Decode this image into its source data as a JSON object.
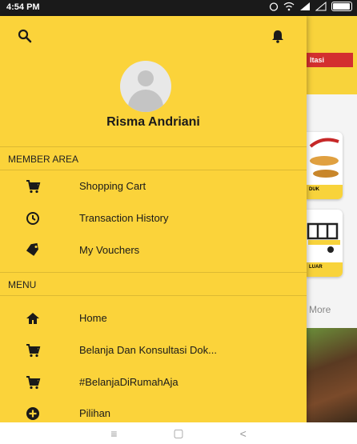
{
  "status": {
    "time": "4:54 PM"
  },
  "background": {
    "consult_label": "ltasi",
    "card1_label": "DUK",
    "card2_label": "LUAR",
    "more_label": "More"
  },
  "drawer": {
    "user_name": "Risma Andriani",
    "member_section": "MEMBER AREA",
    "member_items": [
      {
        "label": "Shopping Cart",
        "icon": "cart-icon"
      },
      {
        "label": "Transaction History",
        "icon": "clock-icon"
      },
      {
        "label": "My Vouchers",
        "icon": "tag-icon"
      }
    ],
    "menu_section": "MENU",
    "menu_items": [
      {
        "label": "Home",
        "icon": "home-icon"
      },
      {
        "label": "Belanja Dan Konsultasi Dok...",
        "icon": "cart-icon"
      },
      {
        "label": "#BelanjaDiRumahAja",
        "icon": "cart-icon"
      },
      {
        "label": "Pilihan",
        "icon": "plus-circle-icon"
      }
    ]
  },
  "navbar": {
    "menu_glyph": "≡",
    "home_glyph": "▢",
    "back_glyph": "<"
  }
}
